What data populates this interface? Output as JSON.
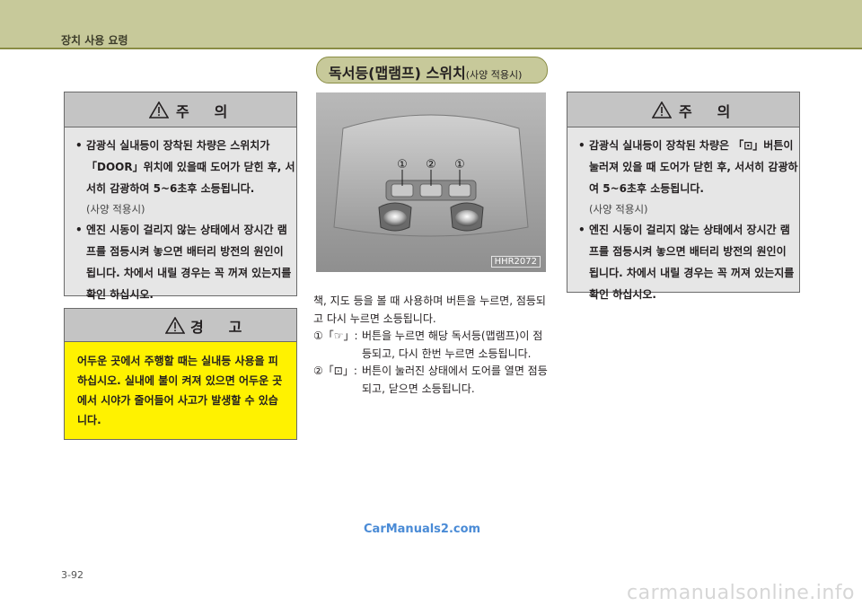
{
  "header": {
    "title": "장치 사용 요령"
  },
  "section": {
    "title": "독서등(맵램프) 스위치",
    "subtitle": "(사양 적용시)"
  },
  "caution_left": {
    "title": "주     의",
    "items": [
      "감광식 실내등이 장착된 차량은 스위치가 「DOOR」위치에 있을때 도어가 닫힌 후, 서서히 감광하여 5~6초후 소등됩니다.",
      "엔진 시동이 걸리지 않는 상태에서 장시간 램프를 점등시켜 놓으면 배터리 방전의 원인이 됩니다. 차에서 내릴 경우는 꼭 꺼져 있는지를 확인 하십시오."
    ],
    "note": "(사양 적용시)"
  },
  "warning": {
    "title": "경     고",
    "body": "어두운 곳에서 주행할 때는 실내등 사용을 피하십시오. 실내에 불이 켜져 있으면 어두운 곳에서 시야가 줄어들어 사고가 발생할 수 있습니다."
  },
  "photo": {
    "code": "HHR2072",
    "callouts": [
      "①",
      "②",
      "①"
    ]
  },
  "description": {
    "intro": "책, 지도 등을 볼 때 사용하며 버튼을 누르면, 점등되고 다시 누르면 소등됩니다.",
    "items": [
      {
        "label": "①「☞」:",
        "text": "버튼을 누르면 해당 독서등(맵램프)이 점등되고, 다시 한번 누르면 소등됩니다."
      },
      {
        "label": "②「⊡」:",
        "text": "버튼이 눌러진 상태에서 도어를 열면 점등되고, 닫으면 소등됩니다."
      }
    ]
  },
  "caution_right": {
    "title": "주     의",
    "items": [
      "감광식 실내등이 장착된 차량은 「⊡」버튼이 눌러져 있을 때 도어가 닫힌 후, 서서히 감광하여 5~6초후 소등됩니다.",
      "엔진 시동이 걸리지 않는 상태에서 장시간 램프를 점등시켜 놓으면 배터리 방전의 원인이 됩니다. 차에서 내릴 경우는 꼭 꺼져 있는지를 확인 하십시오."
    ],
    "note": "(사양 적용시)"
  },
  "watermark": "CarManuals2.com",
  "page_number": "3-92",
  "footer_watermark": "carmanualsonline.info",
  "colors": {
    "header": "#c7c99a",
    "warning": "#fff200",
    "caution_bg": "#e6e6e6"
  }
}
